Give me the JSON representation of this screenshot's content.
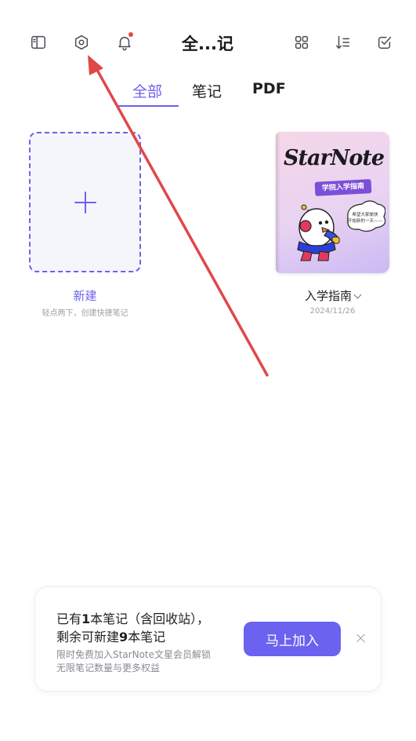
{
  "header": {
    "title": "全...记",
    "left_icons": [
      "sidebar-icon",
      "settings-icon",
      "bell-icon"
    ],
    "right_icons": [
      "grid-view-icon",
      "sort-icon",
      "select-check-icon"
    ],
    "notification_dot_color": "#ef4444"
  },
  "tabs": [
    {
      "label": "全部",
      "active": true
    },
    {
      "label": "笔记",
      "active": false
    },
    {
      "label": "PDF",
      "active": false
    }
  ],
  "new_note": {
    "label": "新建",
    "hint": "轻点两下，创建快捷笔记"
  },
  "notes": [
    {
      "title": "入学指南",
      "date": "2024/11/26",
      "cover": {
        "brand": "StarNote",
        "banner": "学院入学指南",
        "bubble_text": [
          "希望大家愉快",
          "开始新的一天——"
        ]
      }
    }
  ],
  "promo": {
    "line1_prefix": "已有",
    "line1_count": "1",
    "line1_suffix": "本笔记（含回收站），",
    "line2_prefix": "剩余可新建",
    "line2_count": "9",
    "line2_suffix": "本笔记",
    "sub1": "限时免费加入StarNote文星会员解锁",
    "sub2": "无限笔记数量与更多权益",
    "button": "马上加入"
  },
  "colors": {
    "accent": "#6b62f0",
    "annotation_arrow": "#e04848"
  }
}
